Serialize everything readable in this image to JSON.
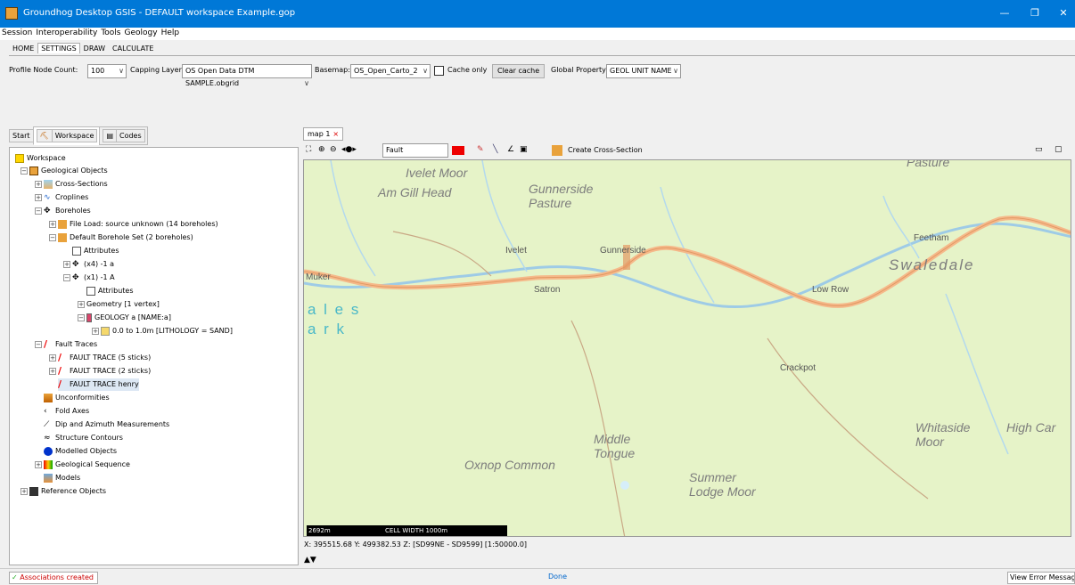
{
  "window": {
    "title": "Groundhog Desktop GSIS - DEFAULT workspace Example.gop",
    "minimize": "—",
    "restore": "❐",
    "close": "✕"
  },
  "menu": [
    "Session",
    "Interoperability",
    "Tools",
    "Geology",
    "Help"
  ],
  "ribbon_tabs": [
    "HOME",
    "SETTINGS",
    "DRAW",
    "CALCULATE"
  ],
  "settings": {
    "profile_label": "Profile Node Count:",
    "profile_value": "100",
    "capping_label": "Capping Layer:",
    "capping_value": "OS Open Data DTM SAMPLE.obgrid",
    "basemap_label": "Basemap:",
    "basemap_value": "OS_Open_Carto_2",
    "cache_only": "Cache only",
    "clear_cache": "Clear cache",
    "global_label": "Global Property:",
    "global_value": "GEOL UNIT NAME",
    "chevron": "∨"
  },
  "left_tabs": [
    "Start",
    "Workspace",
    "Codes"
  ],
  "tree": [
    "Workspace",
    "Geological Objects",
    "Cross-Sections",
    "Croplines",
    "Boreholes",
    "File Load: source unknown (14 boreholes)",
    "Default Borehole Set (2 boreholes)",
    "Attributes",
    "(x4) -1 a",
    "(x1) -1 A",
    "Attributes",
    "Geometry  [1 vertex]",
    "GEOLOGY a  [NAME:a]",
    "0.0 to 1.0m  [LITHOLOGY = SAND]",
    "Fault Traces",
    "FAULT TRACE  (5 sticks)",
    "FAULT TRACE  (2 sticks)",
    "FAULT TRACE henry",
    "Unconformities",
    "Fold Axes",
    "Dip and Azimuth Measurements",
    "Structure Contours",
    "Modelled Objects",
    "Geological Sequence",
    "Models",
    "Reference Objects"
  ],
  "map": {
    "tab": "map 1",
    "tab_close": "×",
    "fault_input": "Fault",
    "create_xs": "Create Cross-Section",
    "places": {
      "ivelet_moor": "Ivelet Moor",
      "am_gill": "Am Gill Head",
      "gunnerside_pasture": "Gunnerside\nPasture",
      "ivelet": "Ivelet",
      "gunnerside": "Gunnerside",
      "muker": "Muker",
      "satron": "Satron",
      "feetham": "Feetham",
      "swaledale": "Swaledale",
      "low_row": "Low Row",
      "ales": "a l e s",
      "ark": "a r k",
      "crackpot": "Crackpot",
      "middle_tongue": "Middle\nTongue",
      "oxnop": "Oxnop Common",
      "summer_lodge": "Summer\nLodge Moor",
      "whitaside": "Whitaside\nMoor",
      "high_car": "High Car",
      "pasture": "Pasture"
    },
    "scale": "2692m",
    "cell_width": "CELL WIDTH 1000m",
    "coords": "X: 395515.68 Y: 499382.53 Z:  [SD99NE - SD9599]  [1:50000.0]"
  },
  "status": {
    "left": "Associations created",
    "center": "Done",
    "right": "View Error Messages"
  }
}
